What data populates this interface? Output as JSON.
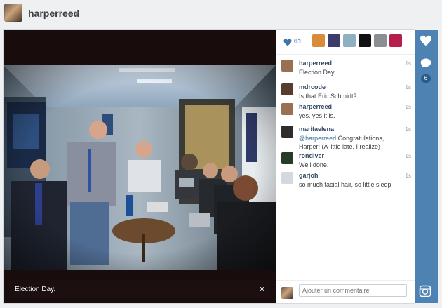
{
  "header": {
    "username": "harperreed",
    "chevron": "▾"
  },
  "post": {
    "likes_count": "61",
    "caption": "Election Day.",
    "close_glyph": "×",
    "likers": [
      "#d98a3a",
      "#3b3c6b",
      "#8db0c3",
      "#111111",
      "#8a8f92",
      "#b61f4c"
    ],
    "comments": [
      {
        "user": "harperreed",
        "text": "Election Day.",
        "time": "1s",
        "avatar": "#9b6f52"
      },
      {
        "user": "mdrcode",
        "text": "Is that Eric Schmidt?",
        "time": "1s",
        "avatar": "#5a3c2f"
      },
      {
        "user": "harperreed",
        "text": "yes. yes it is.",
        "time": "1s",
        "avatar": "#9b6f52"
      },
      {
        "user": "maritaelena",
        "mention": "@harperreed",
        "text": " Congratulations, Harper! (A little late, I realize)",
        "time": "1s",
        "avatar": "#2d2d2d"
      },
      {
        "user": "rondiver",
        "text": "Well done.",
        "time": "1s",
        "avatar": "#283a28"
      },
      {
        "user": "garjoh",
        "text": "so much facial hair, so little sleep",
        "time": "1s",
        "avatar": "#d4d8df"
      }
    ],
    "comment_placeholder": "Ajouter un commentaire"
  },
  "sidebar": {
    "comment_count": "6"
  },
  "colors": {
    "accent": "#4d82b2",
    "link": "#3f73a3"
  }
}
